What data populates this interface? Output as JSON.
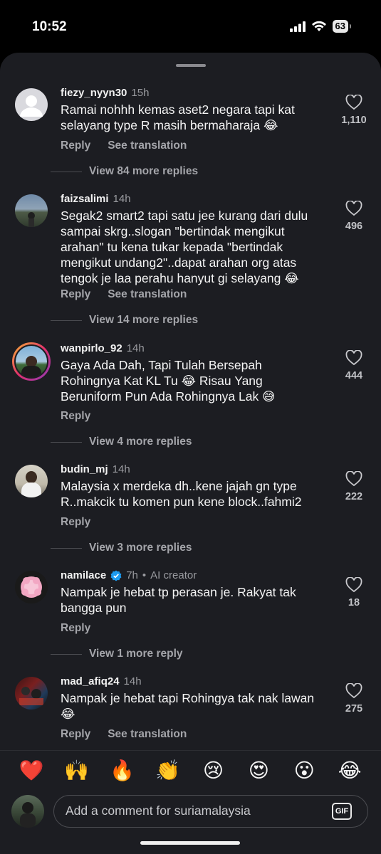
{
  "status": {
    "time": "10:52",
    "battery": "63"
  },
  "comments": [
    {
      "user": "fiezy_nyyn30",
      "time": "15h",
      "text": "Ramai nohhh kemas aset2 negara tapi kat selayang type R masih bermaharaja 😂",
      "likes": "1,110",
      "reply": "Reply",
      "translate": "See translation",
      "more": "View 84 more replies"
    },
    {
      "user": "faizsalimi",
      "time": "14h",
      "text": "Segak2 smart2 tapi satu jee kurang dari dulu sampai skrg..slogan \"bertindak mengikut arahan\" tu kena tukar kepada \"bertindak mengikut undang2\"..dapat arahan org atas tengok je laa perahu hanyut gi selayang 😂",
      "likes": "496",
      "reply": "Reply",
      "translate": "See translation",
      "more": "View 14 more replies"
    },
    {
      "user": "wanpirlo_92",
      "time": "14h",
      "text": "Gaya Ada Dah, Tapi Tulah Bersepah Rohingnya Kat KL Tu 😂 Risau Yang Beruniform Pun Ada Rohingnya Lak 😅",
      "likes": "444",
      "reply": "Reply",
      "more": "View 4 more replies"
    },
    {
      "user": "budin_mj",
      "time": "14h",
      "text": "Malaysia x merdeka dh..kene jajah gn type R..makcik tu komen pun kene block..fahmi2",
      "likes": "222",
      "reply": "Reply",
      "more": "View 3 more replies"
    },
    {
      "user": "namilace",
      "time": "7h",
      "tag": "AI creator",
      "text": "Nampak je hebat tp perasan je. Rakyat tak bangga pun",
      "likes": "18",
      "reply": "Reply",
      "more": "View 1 more reply"
    },
    {
      "user": "mad_afiq24",
      "time": "14h",
      "text": "Nampak je hebat tapi Rohingya tak nak lawan 😂",
      "likes": "275",
      "reply": "Reply",
      "translate": "See translation"
    }
  ],
  "reactions": [
    "❤️",
    "🙌",
    "🔥",
    "👏",
    "😢",
    "😍",
    "😮",
    "😂"
  ],
  "composer": {
    "placeholder": "Add a comment for suriamalaysia",
    "gif_label": "GIF"
  },
  "colors": {
    "sheet": "#1c1d22",
    "text": "#f4f4f4",
    "muted": "#a4a5aa",
    "verified": "#1d9bf0"
  }
}
